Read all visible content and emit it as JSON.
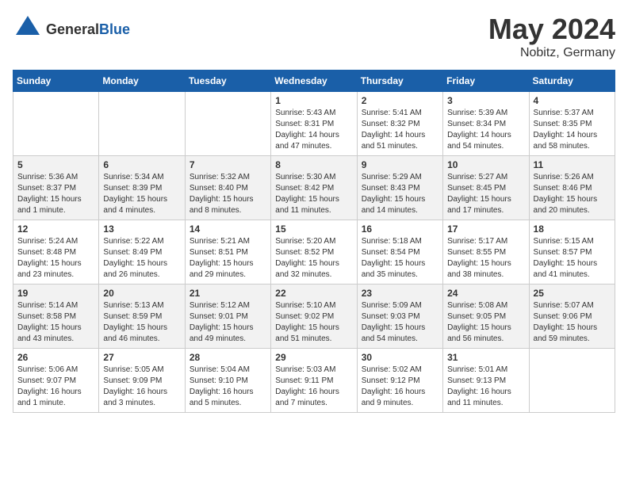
{
  "header": {
    "logo_line1": "General",
    "logo_line2": "Blue",
    "month_year": "May 2024",
    "location": "Nobitz, Germany"
  },
  "columns": [
    "Sunday",
    "Monday",
    "Tuesday",
    "Wednesday",
    "Thursday",
    "Friday",
    "Saturday"
  ],
  "weeks": [
    [
      {
        "day": "",
        "sunrise": "",
        "sunset": "",
        "daylight": ""
      },
      {
        "day": "",
        "sunrise": "",
        "sunset": "",
        "daylight": ""
      },
      {
        "day": "",
        "sunrise": "",
        "sunset": "",
        "daylight": ""
      },
      {
        "day": "1",
        "sunrise": "Sunrise: 5:43 AM",
        "sunset": "Sunset: 8:31 PM",
        "daylight": "Daylight: 14 hours and 47 minutes."
      },
      {
        "day": "2",
        "sunrise": "Sunrise: 5:41 AM",
        "sunset": "Sunset: 8:32 PM",
        "daylight": "Daylight: 14 hours and 51 minutes."
      },
      {
        "day": "3",
        "sunrise": "Sunrise: 5:39 AM",
        "sunset": "Sunset: 8:34 PM",
        "daylight": "Daylight: 14 hours and 54 minutes."
      },
      {
        "day": "4",
        "sunrise": "Sunrise: 5:37 AM",
        "sunset": "Sunset: 8:35 PM",
        "daylight": "Daylight: 14 hours and 58 minutes."
      }
    ],
    [
      {
        "day": "5",
        "sunrise": "Sunrise: 5:36 AM",
        "sunset": "Sunset: 8:37 PM",
        "daylight": "Daylight: 15 hours and 1 minute."
      },
      {
        "day": "6",
        "sunrise": "Sunrise: 5:34 AM",
        "sunset": "Sunset: 8:39 PM",
        "daylight": "Daylight: 15 hours and 4 minutes."
      },
      {
        "day": "7",
        "sunrise": "Sunrise: 5:32 AM",
        "sunset": "Sunset: 8:40 PM",
        "daylight": "Daylight: 15 hours and 8 minutes."
      },
      {
        "day": "8",
        "sunrise": "Sunrise: 5:30 AM",
        "sunset": "Sunset: 8:42 PM",
        "daylight": "Daylight: 15 hours and 11 minutes."
      },
      {
        "day": "9",
        "sunrise": "Sunrise: 5:29 AM",
        "sunset": "Sunset: 8:43 PM",
        "daylight": "Daylight: 15 hours and 14 minutes."
      },
      {
        "day": "10",
        "sunrise": "Sunrise: 5:27 AM",
        "sunset": "Sunset: 8:45 PM",
        "daylight": "Daylight: 15 hours and 17 minutes."
      },
      {
        "day": "11",
        "sunrise": "Sunrise: 5:26 AM",
        "sunset": "Sunset: 8:46 PM",
        "daylight": "Daylight: 15 hours and 20 minutes."
      }
    ],
    [
      {
        "day": "12",
        "sunrise": "Sunrise: 5:24 AM",
        "sunset": "Sunset: 8:48 PM",
        "daylight": "Daylight: 15 hours and 23 minutes."
      },
      {
        "day": "13",
        "sunrise": "Sunrise: 5:22 AM",
        "sunset": "Sunset: 8:49 PM",
        "daylight": "Daylight: 15 hours and 26 minutes."
      },
      {
        "day": "14",
        "sunrise": "Sunrise: 5:21 AM",
        "sunset": "Sunset: 8:51 PM",
        "daylight": "Daylight: 15 hours and 29 minutes."
      },
      {
        "day": "15",
        "sunrise": "Sunrise: 5:20 AM",
        "sunset": "Sunset: 8:52 PM",
        "daylight": "Daylight: 15 hours and 32 minutes."
      },
      {
        "day": "16",
        "sunrise": "Sunrise: 5:18 AM",
        "sunset": "Sunset: 8:54 PM",
        "daylight": "Daylight: 15 hours and 35 minutes."
      },
      {
        "day": "17",
        "sunrise": "Sunrise: 5:17 AM",
        "sunset": "Sunset: 8:55 PM",
        "daylight": "Daylight: 15 hours and 38 minutes."
      },
      {
        "day": "18",
        "sunrise": "Sunrise: 5:15 AM",
        "sunset": "Sunset: 8:57 PM",
        "daylight": "Daylight: 15 hours and 41 minutes."
      }
    ],
    [
      {
        "day": "19",
        "sunrise": "Sunrise: 5:14 AM",
        "sunset": "Sunset: 8:58 PM",
        "daylight": "Daylight: 15 hours and 43 minutes."
      },
      {
        "day": "20",
        "sunrise": "Sunrise: 5:13 AM",
        "sunset": "Sunset: 8:59 PM",
        "daylight": "Daylight: 15 hours and 46 minutes."
      },
      {
        "day": "21",
        "sunrise": "Sunrise: 5:12 AM",
        "sunset": "Sunset: 9:01 PM",
        "daylight": "Daylight: 15 hours and 49 minutes."
      },
      {
        "day": "22",
        "sunrise": "Sunrise: 5:10 AM",
        "sunset": "Sunset: 9:02 PM",
        "daylight": "Daylight: 15 hours and 51 minutes."
      },
      {
        "day": "23",
        "sunrise": "Sunrise: 5:09 AM",
        "sunset": "Sunset: 9:03 PM",
        "daylight": "Daylight: 15 hours and 54 minutes."
      },
      {
        "day": "24",
        "sunrise": "Sunrise: 5:08 AM",
        "sunset": "Sunset: 9:05 PM",
        "daylight": "Daylight: 15 hours and 56 minutes."
      },
      {
        "day": "25",
        "sunrise": "Sunrise: 5:07 AM",
        "sunset": "Sunset: 9:06 PM",
        "daylight": "Daylight: 15 hours and 59 minutes."
      }
    ],
    [
      {
        "day": "26",
        "sunrise": "Sunrise: 5:06 AM",
        "sunset": "Sunset: 9:07 PM",
        "daylight": "Daylight: 16 hours and 1 minute."
      },
      {
        "day": "27",
        "sunrise": "Sunrise: 5:05 AM",
        "sunset": "Sunset: 9:09 PM",
        "daylight": "Daylight: 16 hours and 3 minutes."
      },
      {
        "day": "28",
        "sunrise": "Sunrise: 5:04 AM",
        "sunset": "Sunset: 9:10 PM",
        "daylight": "Daylight: 16 hours and 5 minutes."
      },
      {
        "day": "29",
        "sunrise": "Sunrise: 5:03 AM",
        "sunset": "Sunset: 9:11 PM",
        "daylight": "Daylight: 16 hours and 7 minutes."
      },
      {
        "day": "30",
        "sunrise": "Sunrise: 5:02 AM",
        "sunset": "Sunset: 9:12 PM",
        "daylight": "Daylight: 16 hours and 9 minutes."
      },
      {
        "day": "31",
        "sunrise": "Sunrise: 5:01 AM",
        "sunset": "Sunset: 9:13 PM",
        "daylight": "Daylight: 16 hours and 11 minutes."
      },
      {
        "day": "",
        "sunrise": "",
        "sunset": "",
        "daylight": ""
      }
    ]
  ]
}
